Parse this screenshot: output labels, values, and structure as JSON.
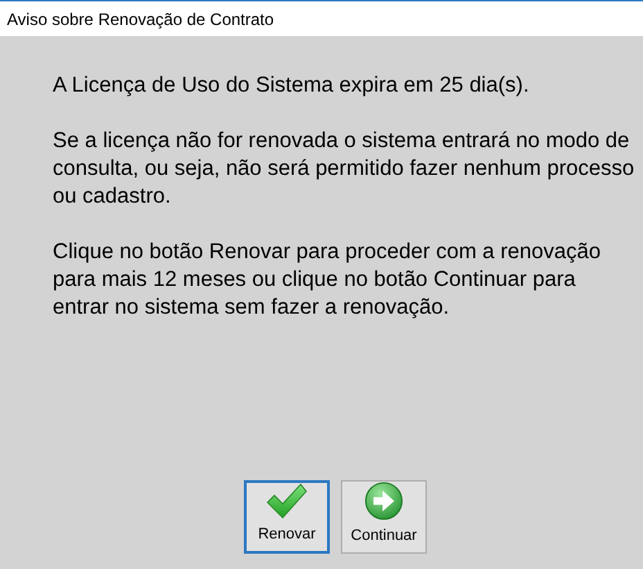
{
  "window": {
    "title": "Aviso sobre Renovação de Contrato"
  },
  "paragraphs": [
    "A Licença de Uso do Sistema expira em 25 dia(s).",
    "Se a licença não for renovada o sistema entrará no modo de consulta, ou seja, não será permitido fazer nenhum processo ou cadastro.",
    "Clique no botão Renovar para proceder com a renovação para mais 12 meses ou clique no botão Continuar para entrar no sistema sem fazer a renovação."
  ],
  "buttons": [
    {
      "label": "Renovar",
      "kind": "check",
      "focused": true
    },
    {
      "label": "Continuar",
      "kind": "arrow",
      "focused": false
    }
  ]
}
